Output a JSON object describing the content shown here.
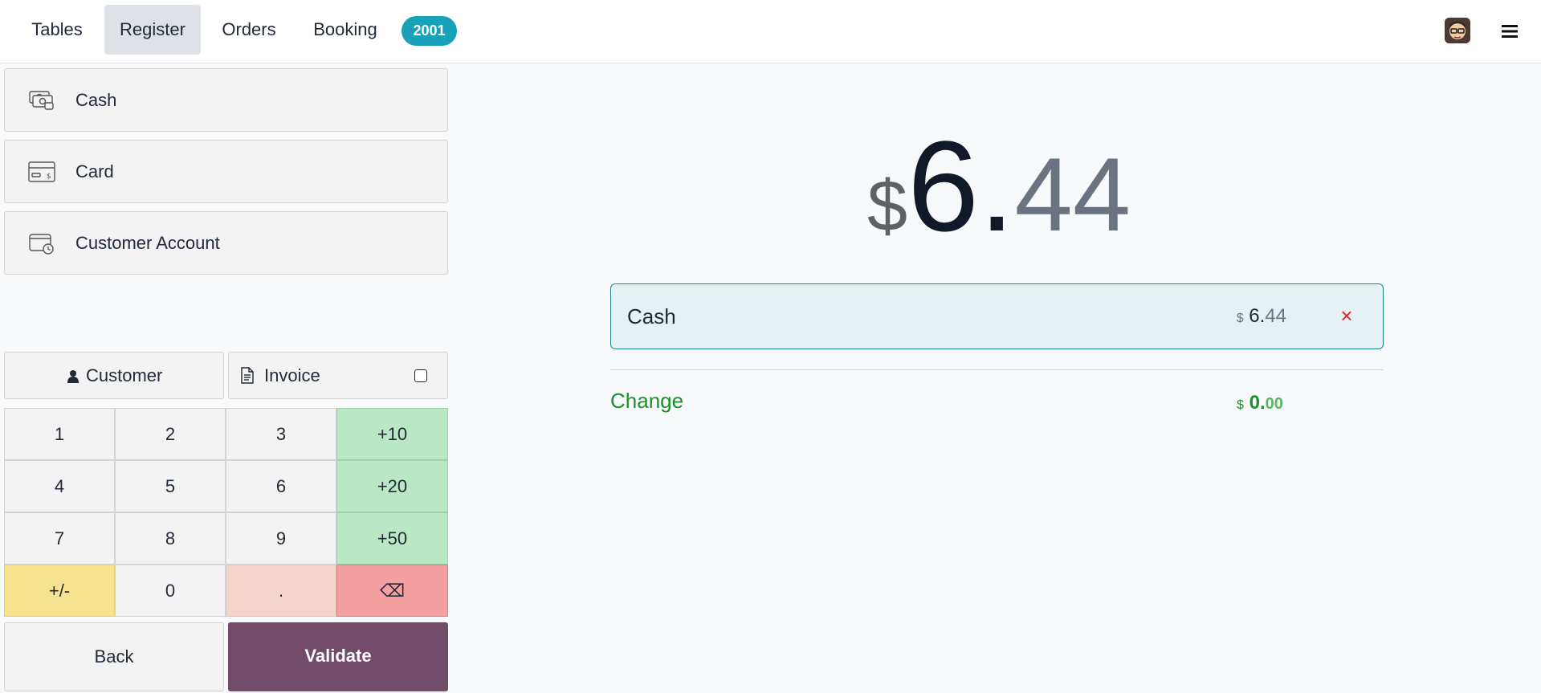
{
  "nav": {
    "tabs": [
      {
        "label": "Tables"
      },
      {
        "label": "Register"
      },
      {
        "label": "Orders"
      },
      {
        "label": "Booking"
      }
    ],
    "active_tab": "Register",
    "order_badge": "2001",
    "avatar_icon": "user-avatar-icon",
    "menu_icon": "hamburger-menu-icon"
  },
  "payment_methods": [
    {
      "label": "Cash",
      "icon": "cash-icon"
    },
    {
      "label": "Card",
      "icon": "card-icon"
    },
    {
      "label": "Customer Account",
      "icon": "wallet-clock-icon"
    }
  ],
  "actions": {
    "customer_label": "Customer",
    "invoice_label": "Invoice",
    "invoice_checked": false
  },
  "numpad": {
    "keys": [
      [
        "1",
        "2",
        "3",
        "+10"
      ],
      [
        "4",
        "5",
        "6",
        "+20"
      ],
      [
        "7",
        "8",
        "9",
        "+50"
      ],
      [
        "+/-",
        "0",
        ".",
        "⌫"
      ]
    ]
  },
  "footer": {
    "back_label": "Back",
    "validate_label": "Validate"
  },
  "total": {
    "currency": "$",
    "int": "6",
    "sep": ".",
    "dec": "44"
  },
  "payment_line": {
    "name": "Cash",
    "currency": "$",
    "int": "6",
    "sep": ".",
    "dec": "44",
    "delete_symbol": "×"
  },
  "change": {
    "label": "Change",
    "currency": "$",
    "int": "0",
    "sep": ".",
    "dec": "00"
  },
  "colors": {
    "badge": "#17a2b8",
    "validate": "#714b67",
    "change": "#1e8f2f",
    "delete": "#dc2626"
  }
}
